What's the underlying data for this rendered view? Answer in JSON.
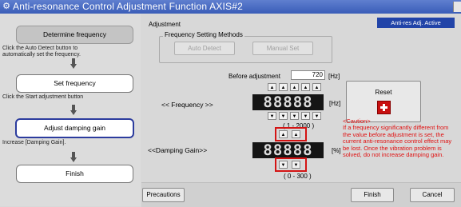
{
  "window": {
    "title": "Anti-resonance Control Adjustment Function AXIS#2",
    "icon": "app-icon"
  },
  "steps": [
    {
      "label": "Determine frequency",
      "note": "Click the Auto Detect button to automatically set the frequency.",
      "state": "inactive"
    },
    {
      "label": "Set frequency",
      "note": "Click the Start adjustment button",
      "state": "normal"
    },
    {
      "label": "Adjust damping gain",
      "note": "Increase [Damping Gain].",
      "state": "active"
    },
    {
      "label": "Finish",
      "note": "",
      "state": "normal"
    }
  ],
  "adjustment": {
    "label": "Adjustment",
    "status_badge": "Anti-res Adj. Active",
    "methods_title": "Frequency Setting Methods",
    "auto_detect": "Auto Detect",
    "manual_set": "Manual Set"
  },
  "frequency": {
    "before_label": "Before adjustment",
    "before_value": "720",
    "before_unit": "[Hz]",
    "label": "<< Frequency >>",
    "display": "88888",
    "unit": "[Hz]",
    "range": "( 1 - 2000 )"
  },
  "damping": {
    "label": "<<Damping Gain>>",
    "display": "88888",
    "unit": "[%]",
    "range": "( 0 - 300 )"
  },
  "spin": {
    "up": "▲",
    "down": "▼"
  },
  "reset": {
    "label": "Reset"
  },
  "caution": "<Caution>\nIf a frequency significantly different from the value before adjustment is set, the current anti-resonance control effect may be lost. Once the vibration problem is solved, do not increase damping gain.",
  "footer": {
    "precautions": "Precautions",
    "finish": "Finish",
    "cancel": "Cancel"
  },
  "colors": {
    "title_bar": "#3a5db8",
    "badge": "#2244a8",
    "caution_text": "#e01010",
    "highlight": "#d41414",
    "active_step_border": "#2c3c9e"
  }
}
